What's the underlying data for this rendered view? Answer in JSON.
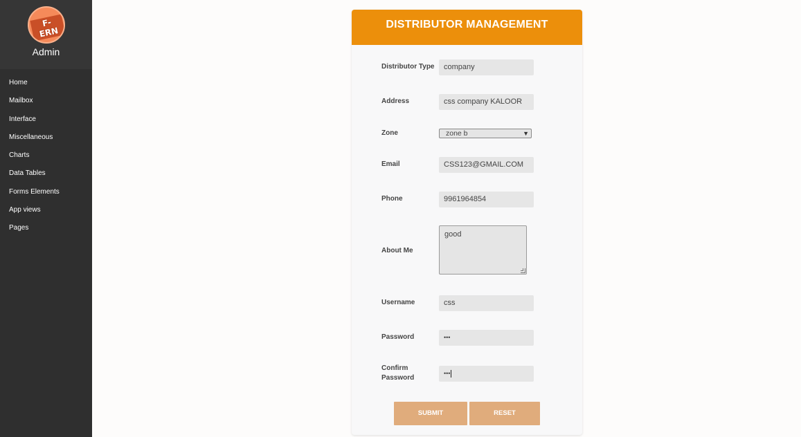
{
  "sidebar": {
    "logo_text": "F-ERN",
    "admin_label": "Admin",
    "menu": [
      "Home",
      "Mailbox",
      "Interface",
      "Miscellaneous",
      "Charts",
      "Data Tables",
      "Forms Elements",
      "App views",
      "Pages"
    ]
  },
  "form": {
    "title": "DISTRIBUTOR MANAGEMENT",
    "distributor_type": {
      "label": "Distributor Type",
      "value": "company"
    },
    "address": {
      "label": "Address",
      "value": "css company KALOOR"
    },
    "zone": {
      "label": "Zone",
      "value": "zone b"
    },
    "email": {
      "label": "Email",
      "value": "CSS123@GMAIL.COM"
    },
    "phone": {
      "label": "Phone",
      "value": "9961964854"
    },
    "about": {
      "label": "About Me",
      "value": "good"
    },
    "username": {
      "label": "Username",
      "value": "css"
    },
    "password": {
      "label": "Password",
      "value": "•••"
    },
    "confirm_password": {
      "label_line1": "Confirm",
      "label_line2": "Password",
      "value": "•••"
    },
    "submit_label": "SUBMIT",
    "reset_label": "RESET"
  },
  "colors": {
    "header": "#ec8f0b",
    "button": "#e0ac7c",
    "sidebar": "#2f2f2f"
  }
}
